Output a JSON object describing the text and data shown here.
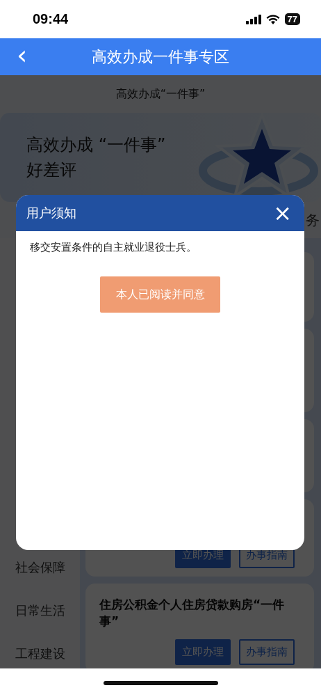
{
  "status_bar": {
    "time": "09:44",
    "battery": "77"
  },
  "header": {
    "back": "‹",
    "title": "高效办成一件事专区"
  },
  "subtitle": "高效办成“一件事”",
  "banner": {
    "title": "高效办成 “一件事”",
    "subtitle": "好差评"
  },
  "tab_fragment": "务",
  "sidebar": {
    "items": [
      {
        "label": "社会保障",
        "selected": false
      },
      {
        "label": "日常生活",
        "selected": false
      },
      {
        "label": "工程建设",
        "selected": false
      }
    ]
  },
  "cards": [
    {
      "buttons": [
        {
          "label": "立即办理",
          "kind": "primary"
        },
        {
          "label": "办事指南",
          "kind": "outline"
        }
      ]
    },
    {
      "title": "住房公积金个人住房贷款购房“一件事”",
      "buttons": [
        {
          "label": "立即办理",
          "kind": "primary"
        },
        {
          "label": "办事指南",
          "kind": "outline"
        }
      ]
    }
  ],
  "dialog": {
    "title": "用户须知",
    "close": "×",
    "text": "移交安置条件的自主就业退役士兵。",
    "button": "本人已阅读并同意"
  }
}
